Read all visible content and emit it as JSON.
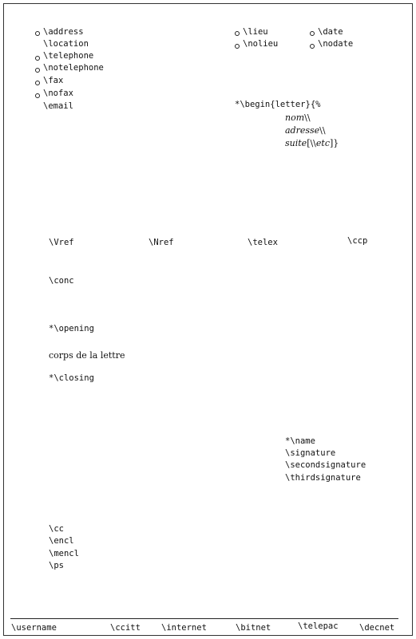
{
  "left_block": {
    "address": "\\address",
    "location": "\\location",
    "telephone": "\\telephone",
    "notelephone": "\\notelephone",
    "fax": "\\fax",
    "nofax": "\\nofax",
    "email": "\\email"
  },
  "right_block": {
    "lieu": "\\lieu",
    "nolieu": "\\nolieu",
    "date": "\\date",
    "nodate": "\\nodate"
  },
  "letter_begin": {
    "command": "*\\begin{letter}{%",
    "nom": "nom",
    "nom_suffix": "\\\\",
    "adresse": "adresse",
    "adresse_suffix": "\\\\",
    "suite": "suite",
    "suite_mid": "[\\\\",
    "etc": "etc",
    "suite_end": "]}"
  },
  "refs": {
    "vref": "\\Vref",
    "nref": "\\Nref",
    "telex": "\\telex",
    "ccp": "\\ccp"
  },
  "conc": "\\conc",
  "opening": "*\\opening",
  "body_text": "corps de la lettre",
  "closing": "*\\closing",
  "signature_block": {
    "name": "*\\name",
    "signature": "\\signature",
    "secondsignature": "\\secondsignature",
    "thirdsignature": "\\thirdsignature"
  },
  "enclosures": {
    "cc": "\\cc",
    "encl": "\\encl",
    "mencl": "\\mencl",
    "ps": "\\ps"
  },
  "footer": {
    "username": "\\username",
    "ccitt": "\\ccitt",
    "internet": "\\internet",
    "bitnet": "\\bitnet",
    "telepac": "\\telepac",
    "decnet": "\\decnet"
  }
}
